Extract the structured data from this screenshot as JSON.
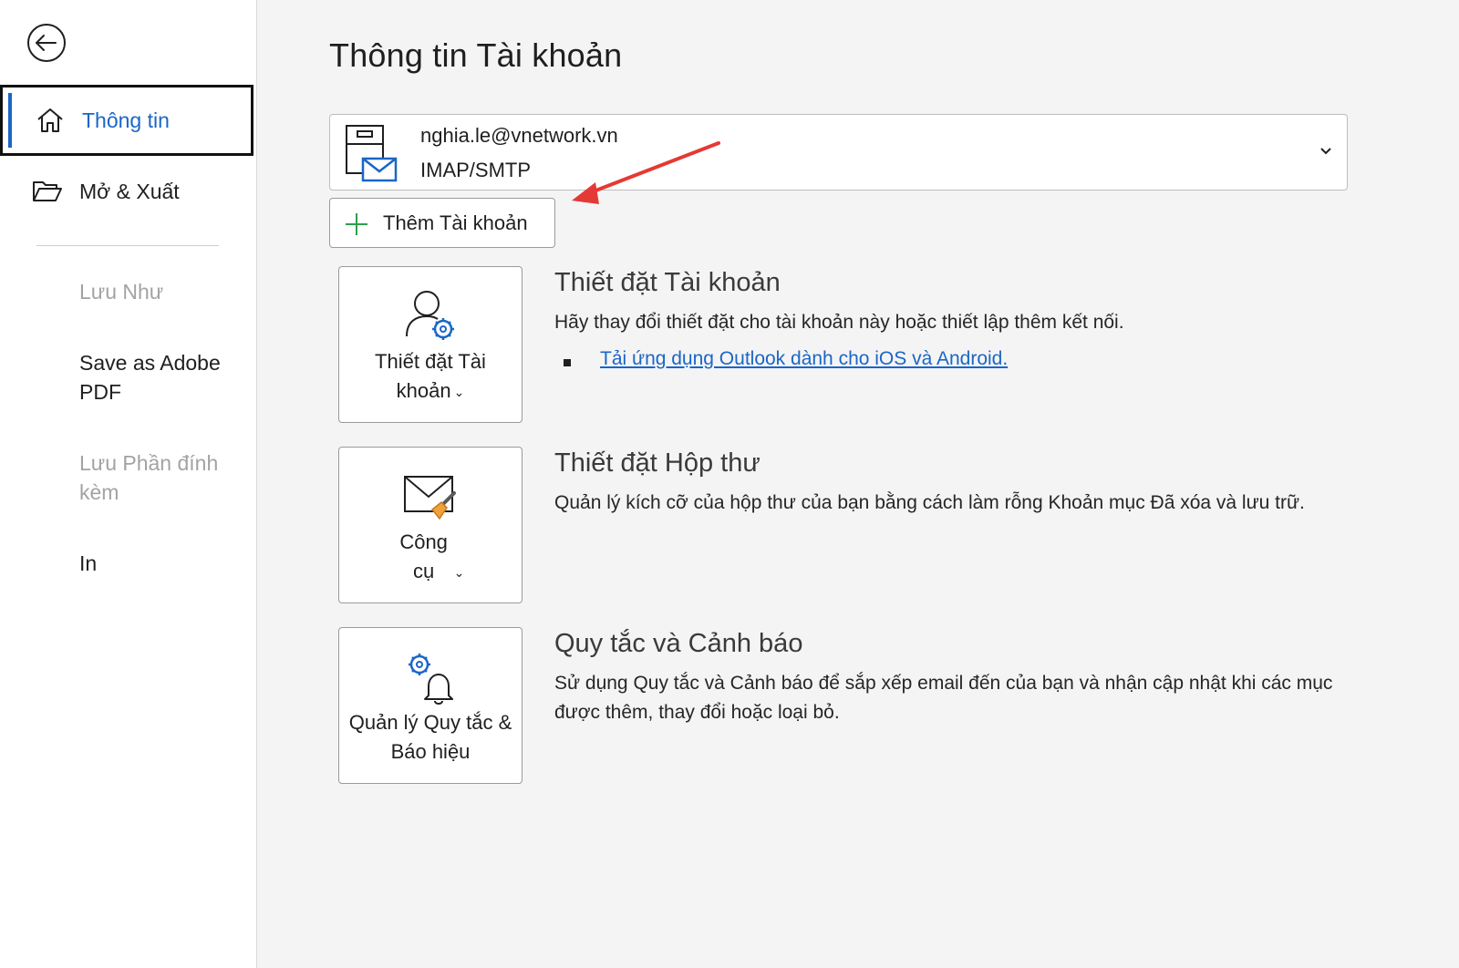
{
  "sidebar": {
    "back_label": "",
    "items": [
      {
        "label": "Thông tin"
      },
      {
        "label": "Mở & Xuất"
      }
    ],
    "secondary": [
      {
        "label": "Lưu Như",
        "disabled": true
      },
      {
        "label": "Save as Adobe PDF",
        "disabled": false
      },
      {
        "label": "Lưu Phần đính kèm",
        "disabled": true
      },
      {
        "label": "In",
        "disabled": false
      }
    ]
  },
  "main": {
    "title": "Thông tin Tài khoản",
    "account": {
      "email": "nghia.le@vnetwork.vn",
      "type": "IMAP/SMTP"
    },
    "add_account_label": "Thêm Tài khoản",
    "sections": [
      {
        "tile_label": "Thiết đặt Tài khoản",
        "tile_icon": "account-settings-icon",
        "title": "Thiết đặt Tài khoản",
        "description": "Hãy thay đổi thiết đặt cho tài khoản này hoặc thiết lập thêm kết nối.",
        "link": "Tải ứng dụng Outlook dành cho iOS và Android."
      },
      {
        "tile_label": "Công cụ",
        "tile_icon": "mailbox-cleanup-icon",
        "title": "Thiết đặt Hộp thư",
        "description": "Quản lý kích cỡ của hộp thư của bạn bằng cách làm rỗng Khoản mục Đã xóa và lưu trữ."
      },
      {
        "tile_label": "Quản lý Quy tắc & Báo hiệu",
        "tile_icon": "rules-alerts-icon",
        "title": "Quy tắc và Cảnh báo",
        "description": "Sử dụng Quy tắc và Cảnh báo để sắp xếp email đến của bạn và nhận cập nhật khi các mục được thêm, thay đổi hoặc loại bỏ."
      }
    ]
  },
  "colors": {
    "accent": "#1a66c7",
    "annotation_arrow": "#e53935",
    "add_icon": "#2e9e4a"
  }
}
